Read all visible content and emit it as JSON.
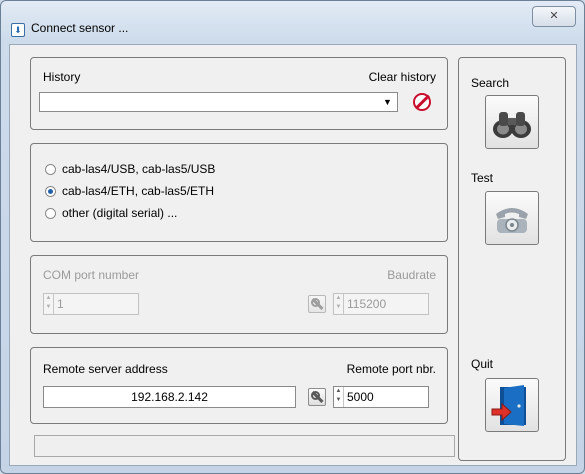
{
  "window": {
    "title": "Connect sensor ...",
    "close_glyph": "✕"
  },
  "history": {
    "label": "History",
    "clear_label": "Clear history",
    "value": "",
    "dropdown_icon": "triangle-down",
    "clear_icon": "no-entry"
  },
  "connection_type": {
    "options": [
      {
        "label": "cab-las4/USB, cab-las5/USB",
        "checked": false
      },
      {
        "label": "cab-las4/ETH, cab-las5/ETH",
        "checked": true
      },
      {
        "label": "other (digital serial) ...",
        "checked": false
      }
    ]
  },
  "serial": {
    "com_label": "COM port number",
    "com_value": "1",
    "baud_label": "Baudrate",
    "baud_value": "115200",
    "enabled": false
  },
  "remote": {
    "address_label": "Remote server address",
    "address_value": "192.168.2.142",
    "port_label": "Remote port nbr.",
    "port_value": "5000"
  },
  "side": {
    "search_label": "Search",
    "search_icon": "binoculars",
    "test_label": "Test",
    "test_icon": "telephone",
    "quit_label": "Quit",
    "quit_icon": "exit-door"
  },
  "status": {
    "text": ""
  },
  "colors": {
    "accent": "#1f5fa8",
    "clear_red": "#c8102e",
    "quit_door_blue": "#1a6fc4",
    "quit_arrow_red": "#e0302a"
  }
}
